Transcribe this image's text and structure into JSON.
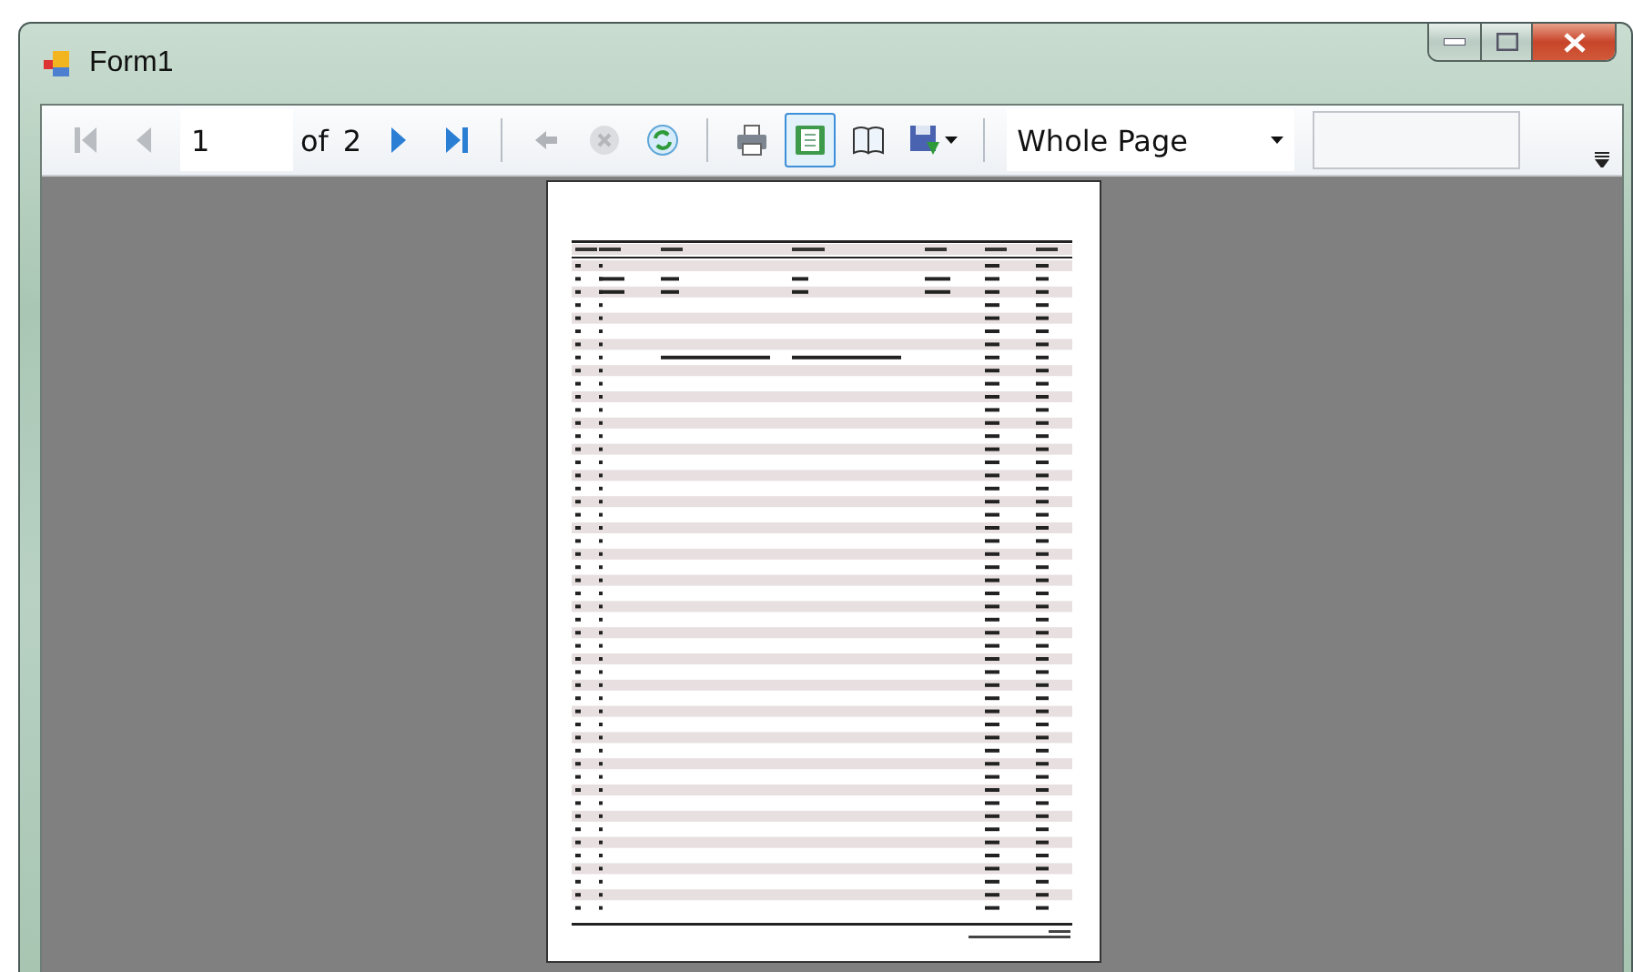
{
  "window": {
    "title": "Form1"
  },
  "toolbar": {
    "items": [
      {
        "kind": "first",
        "disabled": true
      },
      {
        "kind": "prev",
        "disabled": true
      },
      {
        "kind": "page-input",
        "value": "1"
      },
      {
        "kind": "label",
        "text": "of"
      },
      {
        "kind": "label",
        "text": "2"
      },
      {
        "kind": "next",
        "disabled": false
      },
      {
        "kind": "last",
        "disabled": false
      },
      {
        "kind": "separator"
      },
      {
        "kind": "back",
        "disabled": true
      },
      {
        "kind": "stop",
        "disabled": true
      },
      {
        "kind": "refresh",
        "disabled": false
      },
      {
        "kind": "separator"
      },
      {
        "kind": "print",
        "selected": false
      },
      {
        "kind": "print-layout",
        "selected": true
      },
      {
        "kind": "page-setup",
        "selected": false
      },
      {
        "kind": "export",
        "selected": false
      },
      {
        "kind": "separator"
      },
      {
        "kind": "zoom",
        "value": "Whole Page"
      },
      {
        "kind": "search"
      },
      {
        "kind": "overflow"
      }
    ]
  }
}
